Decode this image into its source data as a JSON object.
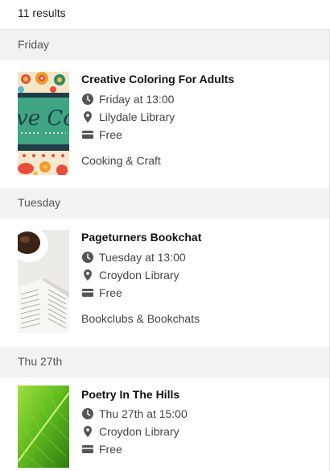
{
  "results": {
    "count_text": "11 results"
  },
  "groups": [
    {
      "day": "Friday",
      "event": {
        "title": "Creative Coloring For Adults",
        "when": "Friday at 13:00",
        "where": "Lilydale Library",
        "price": "Free",
        "category": "Cooking & Craft",
        "thumb_text": "ve Co"
      }
    },
    {
      "day": "Tuesday",
      "event": {
        "title": "Pageturners Bookchat",
        "when": "Tuesday at 13:00",
        "where": "Croydon Library",
        "price": "Free",
        "category": "Bookclubs & Bookchats"
      }
    },
    {
      "day": "Thu 27th",
      "event": {
        "title": "Poetry In The Hills",
        "when": "Thu 27th at 15:00",
        "where": "Croydon Library",
        "price": "Free"
      }
    }
  ],
  "icons": {
    "time": "clock-icon",
    "location": "map-pin-icon",
    "price": "ticket-icon"
  },
  "colors": {
    "header_bg": "#f2f2f2",
    "text": "#1c1c1c",
    "muted": "#444444"
  }
}
